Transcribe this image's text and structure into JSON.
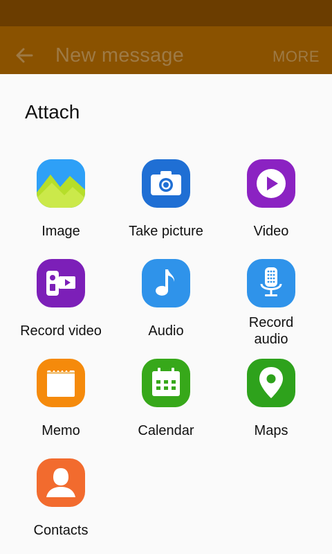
{
  "appbar": {
    "title": "New message",
    "more_label": "MORE"
  },
  "sheet": {
    "title": "Attach"
  },
  "items": [
    {
      "label": "Image",
      "icon": "gallery-icon",
      "color": "#2e9cf5"
    },
    {
      "label": "Take picture",
      "icon": "camera-icon",
      "color": "#1f6fd4"
    },
    {
      "label": "Video",
      "icon": "video-play-icon",
      "color": "#8b22c2"
    },
    {
      "label": "Record video",
      "icon": "video-recorder-icon",
      "color": "#7c1fb8"
    },
    {
      "label": "Audio",
      "icon": "music-note-icon",
      "color": "#2f93ea"
    },
    {
      "label": "Record audio",
      "icon": "microphone-icon",
      "color": "#2f93ea"
    },
    {
      "label": "Memo",
      "icon": "memo-icon",
      "color": "#f58a0b"
    },
    {
      "label": "Calendar",
      "icon": "calendar-icon",
      "color": "#37a81a"
    },
    {
      "label": "Maps",
      "icon": "map-pin-icon",
      "color": "#2ea21c"
    },
    {
      "label": "Contacts",
      "icon": "contact-icon",
      "color": "#f26b2e"
    }
  ]
}
